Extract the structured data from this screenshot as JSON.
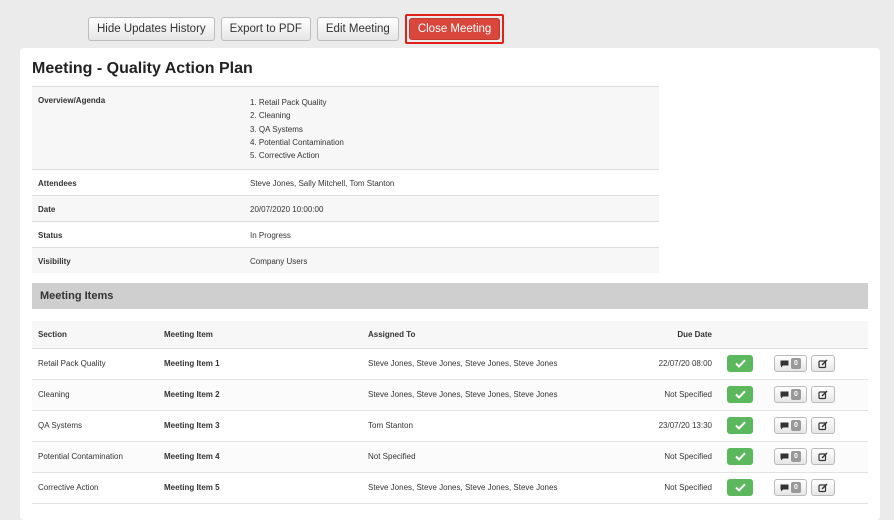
{
  "toolbar": {
    "hide_updates": "Hide Updates History",
    "export_pdf": "Export to PDF",
    "edit_meeting": "Edit Meeting",
    "close_meeting": "Close Meeting"
  },
  "meeting": {
    "title": "Meeting - Quality Action Plan",
    "labels": {
      "overview": "Overview/Agenda",
      "attendees": "Attendees",
      "date": "Date",
      "status": "Status",
      "visibility": "Visibility"
    },
    "agenda": [
      "1. Retail Pack Quality",
      "2. Cleaning",
      "3. QA Systems",
      "4. Potential Contamination",
      "5. Corrective Action"
    ],
    "attendees": "Steve Jones, Sally Mitchell, Tom Stanton",
    "date": "20/07/2020 10:00:00",
    "status": "In Progress",
    "visibility": "Company Users"
  },
  "items_section": {
    "heading": "Meeting Items",
    "columns": {
      "section": "Section",
      "item": "Meeting Item",
      "assigned": "Assigned To",
      "due": "Due Date"
    },
    "rows": [
      {
        "section": "Retail Pack Quality",
        "item": "Meeting Item 1",
        "assigned": "Steve Jones, Steve Jones, Steve Jones, Steve Jones",
        "due": "22/07/20 08:00",
        "comments": "0"
      },
      {
        "section": "Cleaning",
        "item": "Meeting Item 2",
        "assigned": "Steve Jones, Steve Jones, Steve Jones, Steve Jones",
        "due": "Not Specified",
        "comments": "0"
      },
      {
        "section": "QA Systems",
        "item": "Meeting Item 3",
        "assigned": "Tom Stanton",
        "due": "23/07/20 13:30",
        "comments": "0"
      },
      {
        "section": "Potential Contamination",
        "item": "Meeting Item 4",
        "assigned": "Not Specified",
        "due": "Not Specified",
        "comments": "0"
      },
      {
        "section": "Corrective Action",
        "item": "Meeting Item 5",
        "assigned": "Steve Jones, Steve Jones, Steve Jones, Steve Jones",
        "due": "Not Specified",
        "comments": "0"
      }
    ]
  },
  "colors": {
    "close_button": "#d9463b",
    "complete_button": "#5cb85c",
    "highlight_outline": "#e0201a"
  },
  "icons": {
    "complete": "check-icon",
    "comments": "comment-icon",
    "edit": "edit-icon"
  }
}
